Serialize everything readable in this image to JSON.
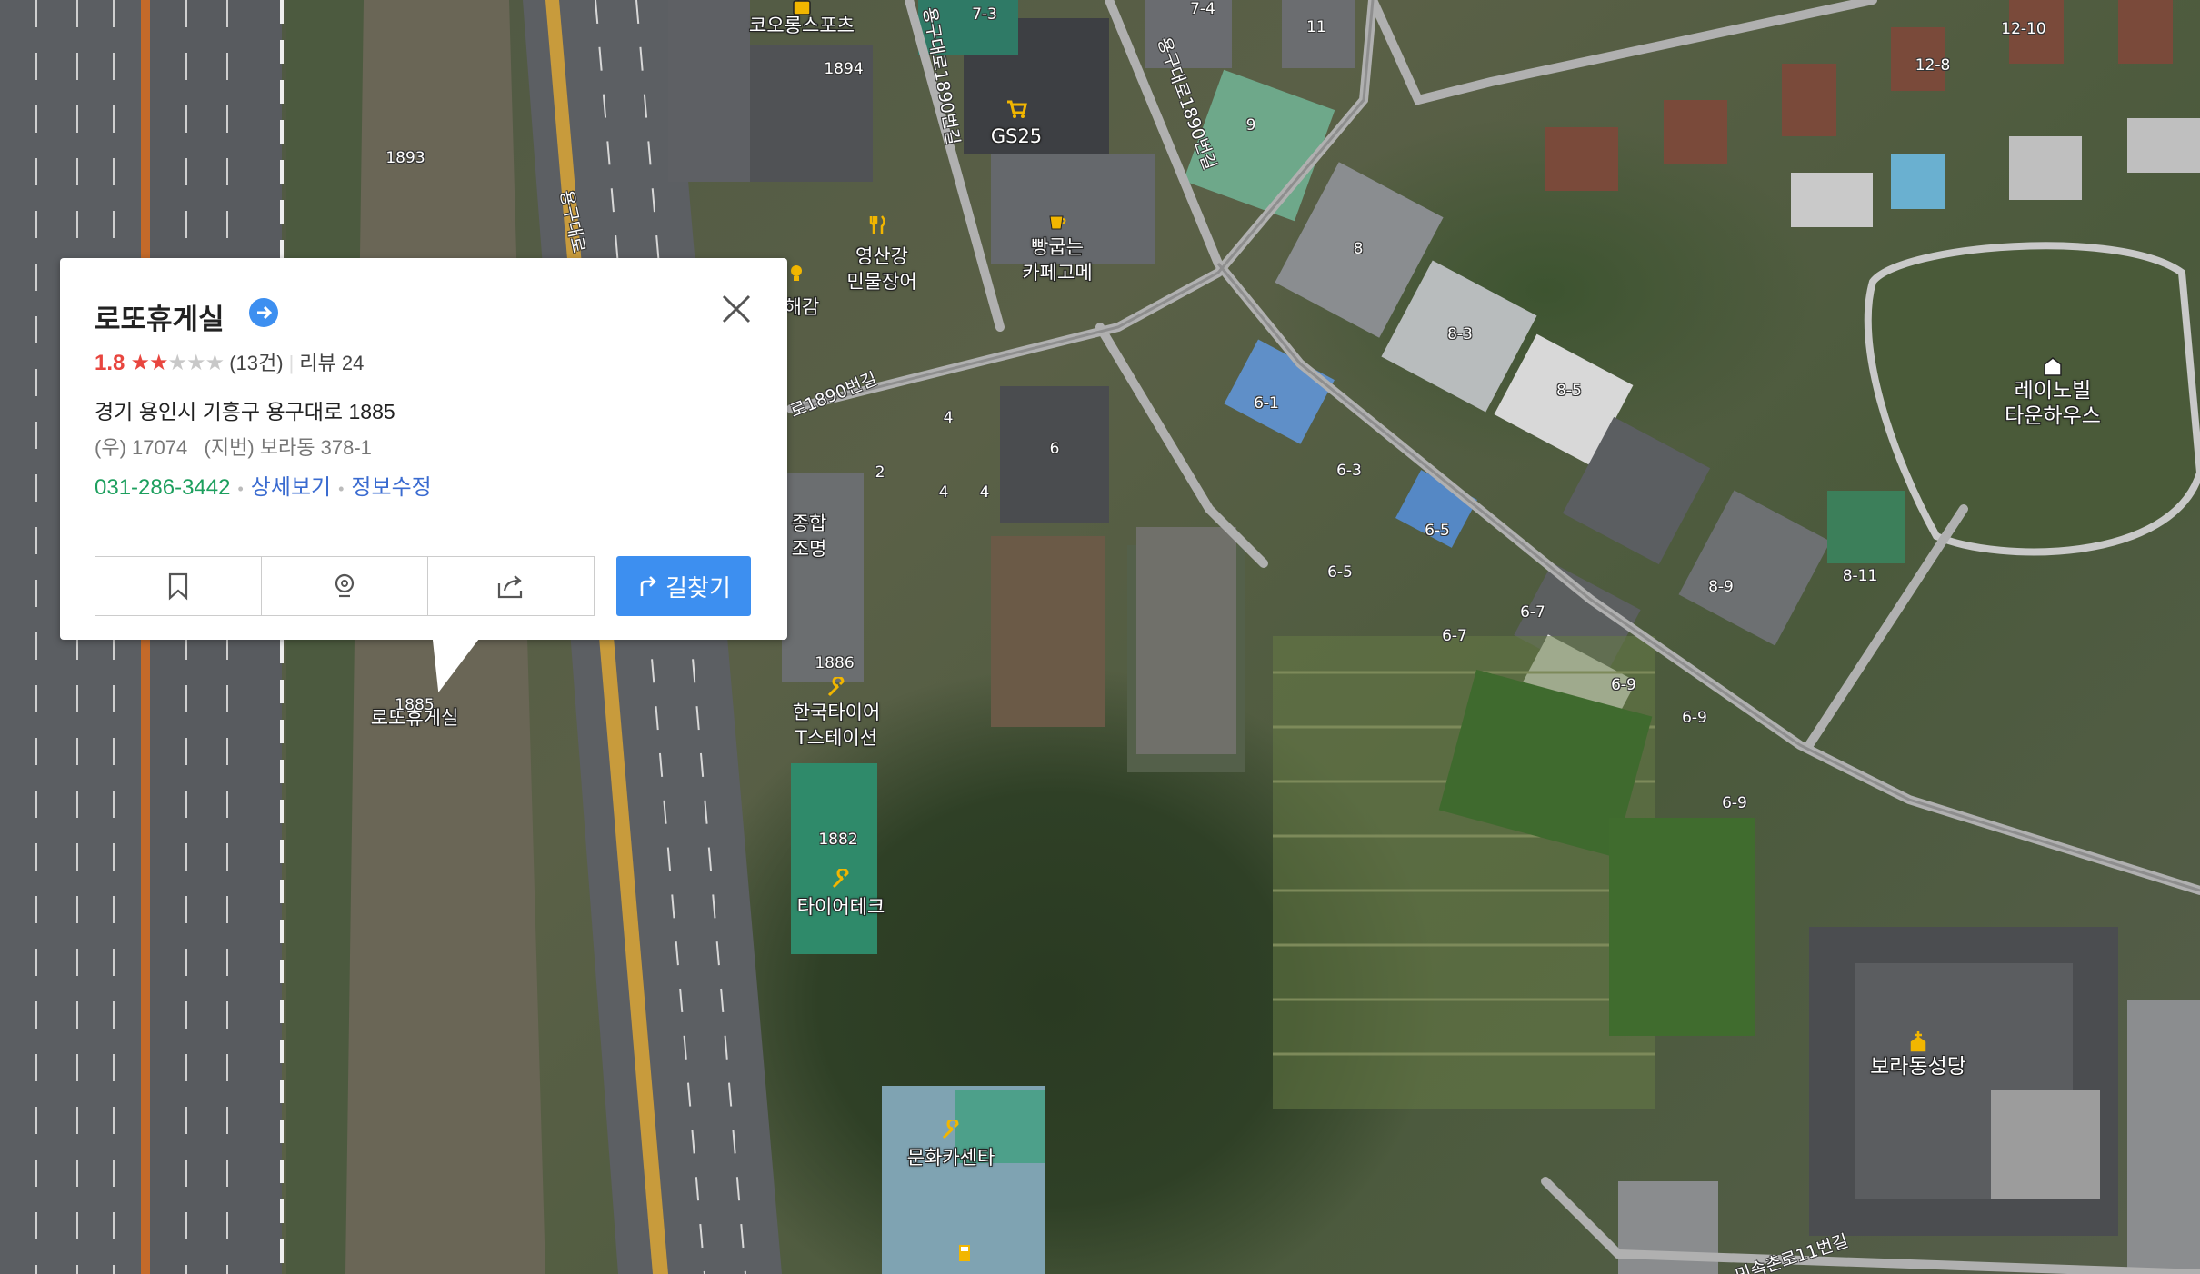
{
  "popup": {
    "title": "로또휴게실",
    "rating": "1.8",
    "rating_value": 1.8,
    "count": "(13건)",
    "review": "리뷰 24",
    "address": "경기 용인시 기흥구 용구대로 1885",
    "postal": "(우) 17074",
    "lot_address": "(지번) 보라동 378-1",
    "phone": "031-286-3442",
    "detail_link": "상세보기",
    "edit_link": "정보수정",
    "route_label": "길찾기",
    "icons": [
      "arrow-right-icon",
      "close-icon",
      "bookmark-icon",
      "roadview-icon",
      "share-icon",
      "route-icon"
    ]
  },
  "map": {
    "places": [
      {
        "name": "코오롱스포츠"
      },
      {
        "name": "GS25"
      },
      {
        "name": "빵굽는\n카페고메"
      },
      {
        "name": "영산강\n민물장어"
      },
      {
        "name": "레이노빌\n타운하우스"
      },
      {
        "name": "한국타이어\nT스테이션"
      },
      {
        "name": "타이어테크"
      },
      {
        "name": "보라동성당"
      },
      {
        "name": "로또휴게실"
      },
      {
        "name": "문화카센타"
      },
      {
        "name": "종합\n조명"
      },
      {
        "name": "해감"
      }
    ],
    "road_names": [
      "용구대로1890번길",
      "용구대로1890번길",
      "용구대로",
      "로1890번길",
      "민속촌로11번길"
    ],
    "lot_numbers": [
      "1894",
      "1893",
      "1886",
      "1882",
      "1885",
      "7-3",
      "7-4",
      "11",
      "9",
      "8",
      "8-3",
      "8-5",
      "6-1",
      "6-3",
      "6-5",
      "6-5",
      "6-7",
      "6-7",
      "6-9",
      "6-9",
      "6-9",
      "8-9",
      "8-11",
      "12-8",
      "12-10",
      "4",
      "4",
      "4",
      "2",
      "6"
    ]
  }
}
